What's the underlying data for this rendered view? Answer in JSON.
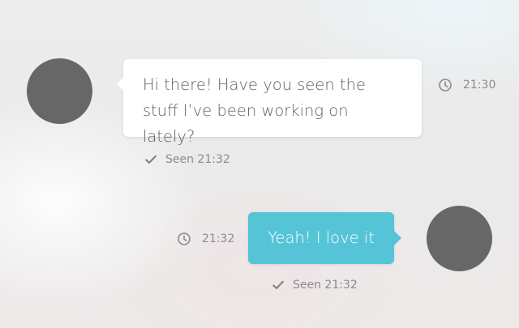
{
  "conversation": {
    "incoming": {
      "message": "Hi there! Have you seen the stuff I’ve been working on lately?",
      "time": "21:30",
      "seen": "Seen 21:32"
    },
    "outgoing": {
      "message": "Yeah! I love it",
      "time": "21:32",
      "seen": "Seen 21:32"
    }
  },
  "icons": {
    "clock": "clock-icon",
    "check": "check-icon"
  },
  "colors": {
    "avatar": "#676767",
    "incoming_bubble": "#ffffff",
    "outgoing_bubble": "#56c4d7",
    "meta_text": "#8b8b8b"
  }
}
